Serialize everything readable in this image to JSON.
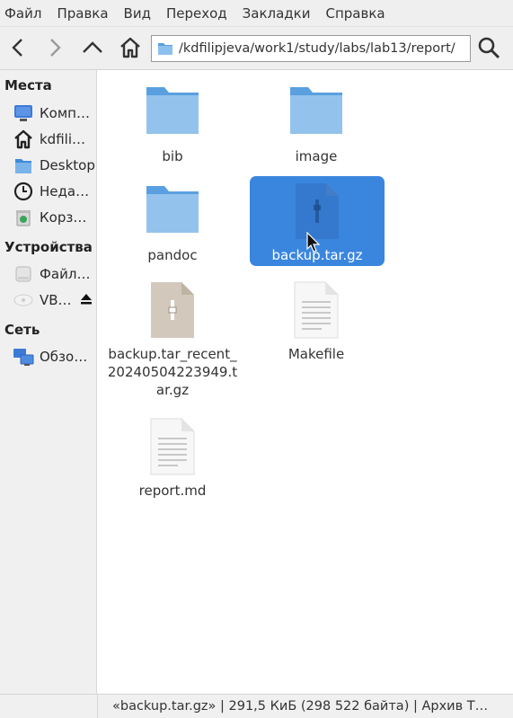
{
  "menu": [
    "Файл",
    "Правка",
    "Вид",
    "Переход",
    "Закладки",
    "Справка"
  ],
  "toolbar": {
    "back_icon": "chevron-left-icon",
    "forward_icon": "chevron-right-icon",
    "up_icon": "chevron-up-icon",
    "home_icon": "home-icon",
    "search_icon": "search-icon",
    "location": "/kdfilipjeva/work1/study/labs/lab13/report/"
  },
  "sidebar": {
    "places_header": "Места",
    "places": [
      {
        "label": "Комп…",
        "icon": "computer-icon"
      },
      {
        "label": "kdfili…",
        "icon": "home-icon"
      },
      {
        "label": "Desktop",
        "icon": "desktop-folder-icon"
      },
      {
        "label": "Неда…",
        "icon": "recent-clock-icon"
      },
      {
        "label": "Корз…",
        "icon": "trash-icon"
      }
    ],
    "devices_header": "Устройства",
    "devices": [
      {
        "label": "Файл…",
        "icon": "drive-icon"
      },
      {
        "label": "VB…",
        "icon": "optical-disc-icon",
        "eject_icon": "eject-icon"
      }
    ],
    "network_header": "Сеть",
    "network": [
      {
        "label": "Обзо…",
        "icon": "network-icon"
      }
    ]
  },
  "files": [
    {
      "name": "bib",
      "type": "folder"
    },
    {
      "name": "image",
      "type": "folder"
    },
    {
      "name": "pandoc",
      "type": "folder"
    },
    {
      "name": "backup.tar.gz",
      "type": "archive",
      "selected": true
    },
    {
      "name": "backup.tar_recent_\n20240504223949.t\nar.gz",
      "type": "archive"
    },
    {
      "name": "Makefile",
      "type": "text"
    },
    {
      "name": "report.md",
      "type": "text"
    }
  ],
  "status": "«backup.tar.gz» | 291,5 КиБ (298 522 байта) | Архив Т…",
  "colors": {
    "selection": "#3a86df",
    "folder": "#5aa0e0",
    "archive": "#d2c9bc"
  }
}
